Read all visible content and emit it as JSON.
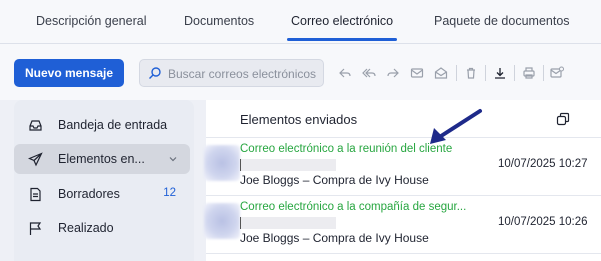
{
  "tabs": [
    {
      "label": "Descripción general"
    },
    {
      "label": "Documentos"
    },
    {
      "label": "Correo electrónico"
    },
    {
      "label": "Paquete de documentos"
    }
  ],
  "toolbar": {
    "new_message_label": "Nuevo mensaje",
    "search_placeholder": "Buscar correos electrónicos"
  },
  "sidebar": {
    "items": [
      {
        "label": "Bandeja de entrada",
        "icon": "inbox-icon"
      },
      {
        "label": "Elementos en...",
        "icon": "send-icon"
      },
      {
        "label": "Borradores",
        "icon": "drafts-icon",
        "count": "12"
      },
      {
        "label": "Realizado",
        "icon": "flag-icon"
      }
    ]
  },
  "panel": {
    "title": "Elementos enviados",
    "mails": [
      {
        "subject": "Correo electrónico a la reunión del cliente",
        "sender": "Joe Bloggs – Compra de Ivy House",
        "date": "10/07/2025 10:27"
      },
      {
        "subject": "Correo electrónico a la compañía de segur...",
        "sender": "Joe Bloggs – Compra de Ivy House",
        "date": "10/07/2025 10:26"
      }
    ]
  },
  "colors": {
    "accent": "#1f5fd6",
    "subject_green": "#27a640",
    "arrow": "#1e2a8a"
  }
}
